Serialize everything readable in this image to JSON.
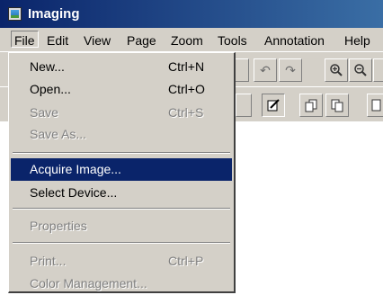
{
  "window": {
    "title": "Imaging",
    "icon": "imaging-app-icon"
  },
  "menubar": {
    "items": [
      "File",
      "Edit",
      "View",
      "Page",
      "Zoom",
      "Tools",
      "Annotation",
      "Help"
    ],
    "active": "File"
  },
  "file_menu": {
    "new": {
      "label": "New...",
      "shortcut": "Ctrl+N"
    },
    "open": {
      "label": "Open...",
      "shortcut": "Ctrl+O"
    },
    "save": {
      "label": "Save",
      "shortcut": "Ctrl+S"
    },
    "save_as": {
      "label": "Save As..."
    },
    "acquire_image": {
      "label": "Acquire Image..."
    },
    "select_device": {
      "label": "Select Device..."
    },
    "properties": {
      "label": "Properties"
    },
    "print": {
      "label": "Print...",
      "shortcut": "Ctrl+P"
    },
    "color_management": {
      "label": "Color Management..."
    }
  },
  "toolbar": {
    "row1": [
      "undo-icon",
      "redo-icon",
      "zoom-in-icon",
      "zoom-out-icon"
    ],
    "row2": [
      "annotation-pen-icon",
      "page-prev-icon",
      "page-next-icon",
      "page-icon"
    ]
  },
  "colors": {
    "highlight": "#0a246a",
    "face": "#d4d0c8",
    "title_start": "#0a246a",
    "title_end": "#3a6ea5"
  }
}
